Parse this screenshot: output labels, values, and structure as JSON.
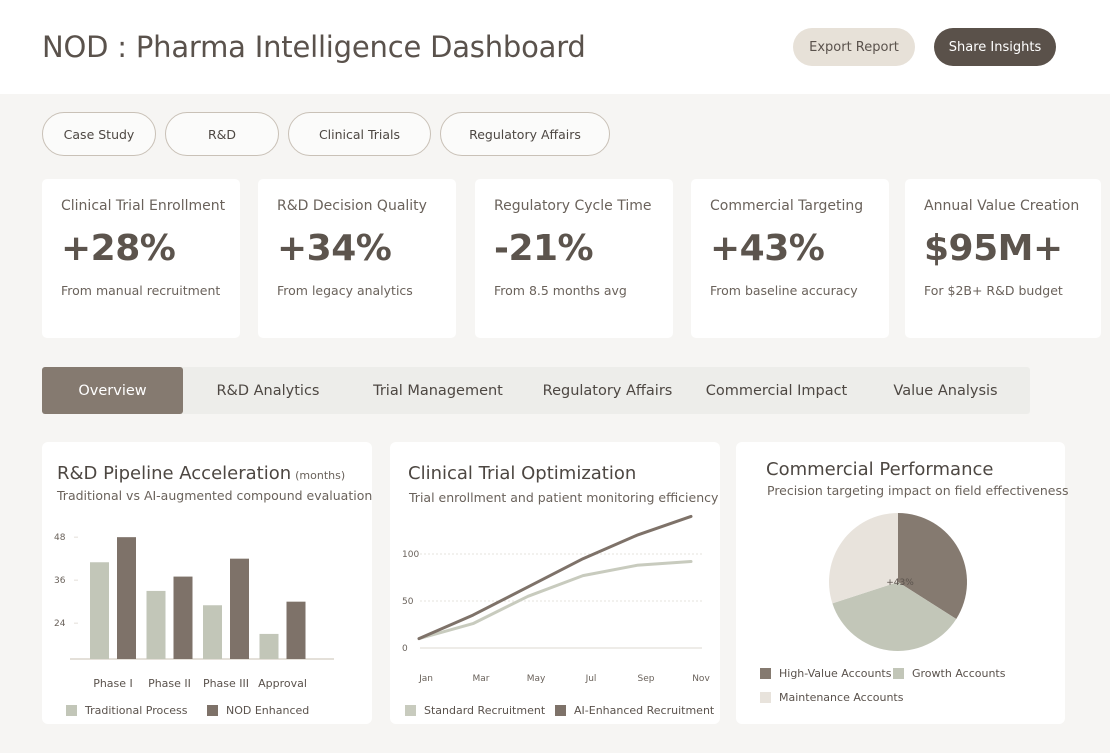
{
  "header": {
    "title": "NOD : Pharma Intelligence Dashboard",
    "export_label": "Export Report",
    "share_label": "Share Insights"
  },
  "filters": [
    "Case Study",
    "R&D",
    "Clinical Trials",
    "Regulatory Affairs"
  ],
  "kpis": [
    {
      "label": "Clinical Trial Enrollment",
      "value": "+28%",
      "sub": "From manual recruitment"
    },
    {
      "label": "R&D Decision Quality",
      "value": "+34%",
      "sub": "From legacy analytics"
    },
    {
      "label": "Regulatory Cycle Time",
      "value": "-21%",
      "sub": "From 8.5 months avg"
    },
    {
      "label": "Commercial Targeting",
      "value": "+43%",
      "sub": "From baseline accuracy"
    },
    {
      "label": "Annual Value Creation",
      "value": "$95M+",
      "sub": "For $2B+ R&D budget"
    }
  ],
  "tabs": [
    "Overview",
    "R&D Analytics",
    "Trial Management",
    "Regulatory Affairs",
    "Commercial Impact",
    "Value Analysis"
  ],
  "active_tab": "Overview",
  "colors": {
    "accent_dark": "#5a514a",
    "bar_traditional": "#c2c6b8",
    "bar_enhanced": "#7e7269",
    "line_enhanced": "#7e7269",
    "line_standard": "#c8cbbe",
    "pie_high_value": "#857a70",
    "pie_growth": "#c2c6b8",
    "pie_maintenance": "#e8e3dc"
  },
  "charts": {
    "pipeline": {
      "title": "R&D Pipeline Acceleration",
      "title_note": "(months)",
      "subtitle": "Traditional vs AI-augmented compound evaluation"
    },
    "trial": {
      "title": "Clinical Trial Optimization",
      "subtitle": "Trial enrollment and patient monitoring efficiency"
    },
    "commercial": {
      "title": "Commercial Performance",
      "subtitle": "Precision targeting impact on field effectiveness"
    }
  },
  "chart_data": [
    {
      "type": "bar",
      "categories": [
        "Phase I",
        "Phase II",
        "Phase III",
        "Approval"
      ],
      "yticks": [
        24,
        36,
        48
      ],
      "ylim": [
        14,
        50
      ],
      "series": [
        {
          "name": "Traditional Process",
          "values": [
            41,
            33,
            29,
            21
          ]
        },
        {
          "name": "NOD  Enhanced",
          "values": [
            48,
            37,
            42,
            30
          ]
        }
      ],
      "grid": false
    },
    {
      "type": "line",
      "x": [
        "Jan",
        "Mar",
        "May",
        "Jul",
        "Sep",
        "Nov"
      ],
      "yticks": [
        0,
        50,
        100
      ],
      "ylim": [
        0,
        130
      ],
      "series": [
        {
          "name": "Standard Recruitment",
          "values": [
            10,
            26,
            55,
            77,
            88,
            92
          ]
        },
        {
          "name": "AI-Enhanced Recruitment",
          "values": [
            10,
            35,
            65,
            95,
            120,
            140
          ]
        }
      ],
      "grid": true
    },
    {
      "type": "pie",
      "labels": [
        "High-Value Accounts",
        "Growth Accounts",
        "Maintenance Accounts"
      ],
      "values": [
        34,
        36,
        30
      ],
      "center_label": "+43%"
    }
  ]
}
